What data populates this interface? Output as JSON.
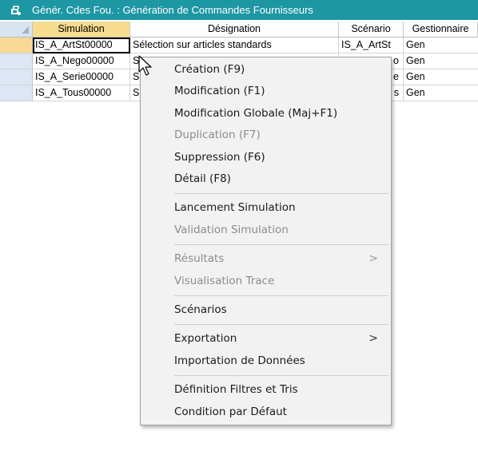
{
  "window": {
    "title": "Génér. Cdes Fou. : Génération de Commandes Fournisseurs",
    "icon": "app-icon"
  },
  "grid": {
    "columns": [
      "Simulation",
      "Désignation",
      "Scénario",
      "Gestionnaire"
    ],
    "highlighted_column": "Simulation",
    "rows": [
      {
        "simulation": "IS_A_ArtSt00000",
        "designation": "Sélection sur articles standards",
        "scenario": "IS_A_ArtSt",
        "gestionnaire": "Gen"
      },
      {
        "simulation": "IS_A_Nego00000",
        "designation": "S",
        "scenario": "o",
        "gestionnaire": "Gen"
      },
      {
        "simulation": "IS_A_Serie00000",
        "designation": "S",
        "scenario": "e",
        "gestionnaire": "Gen"
      },
      {
        "simulation": "IS_A_Tous00000",
        "designation": "S",
        "scenario": "s",
        "gestionnaire": "Gen"
      }
    ]
  },
  "context_menu": {
    "items": [
      {
        "label": "Création (F9)",
        "enabled": true
      },
      {
        "label": "Modification (F1)",
        "enabled": true
      },
      {
        "label": "Modification Globale (Maj+F1)",
        "enabled": true
      },
      {
        "label": "Duplication (F7)",
        "enabled": false
      },
      {
        "label": "Suppression (F6)",
        "enabled": true
      },
      {
        "label": "Détail (F8)",
        "enabled": true
      },
      {
        "label": "Lancement Simulation",
        "enabled": true
      },
      {
        "label": "Validation Simulation",
        "enabled": false
      },
      {
        "label": "Résultats",
        "enabled": false,
        "submenu": true
      },
      {
        "label": "Visualisation Trace",
        "enabled": false
      },
      {
        "label": "Scénarios",
        "enabled": true
      },
      {
        "label": "Exportation",
        "enabled": true,
        "submenu": true
      },
      {
        "label": "Importation de Données",
        "enabled": true
      },
      {
        "label": "Définition Filtres et Tris",
        "enabled": true
      },
      {
        "label": "Condition par Défaut",
        "enabled": true
      }
    ],
    "submenu_arrow": ">"
  },
  "colors": {
    "titlebar": "#1d97a4",
    "header_highlight": "#f7dc8f",
    "row_selector": "#dce6f4",
    "active_row_selector": "#f8d995",
    "menu_background": "#f2f2f2",
    "disabled_text": "#8c8c8c"
  }
}
